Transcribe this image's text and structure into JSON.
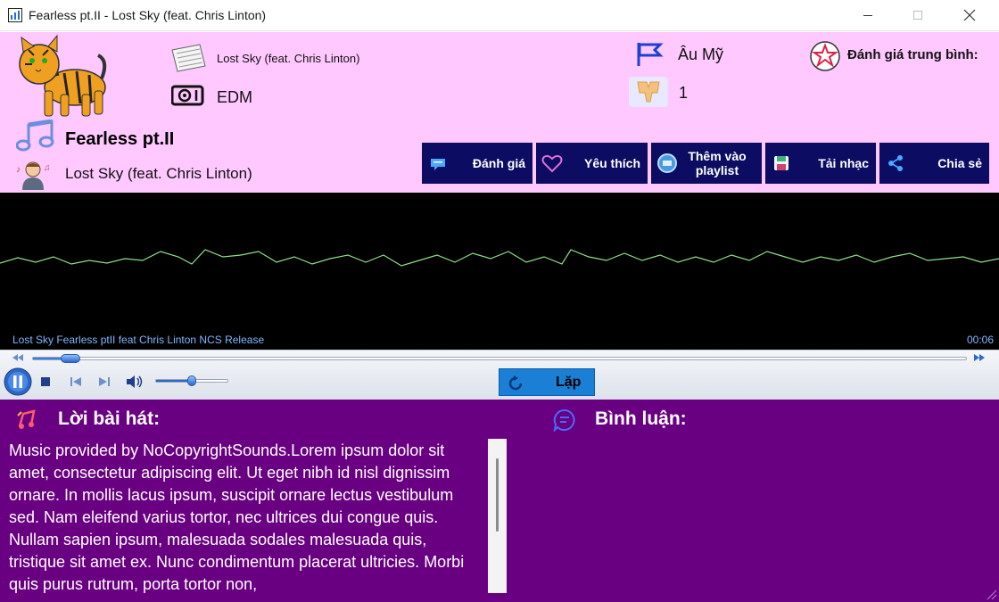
{
  "window": {
    "title": "Fearless pt.II - Lost Sky (feat. Chris Linton)",
    "app_icon": "bar-chart-icon"
  },
  "song": {
    "artist_small": "Lost Sky (feat. Chris Linton)",
    "genre": "EDM",
    "region": "Âu Mỹ",
    "listens": "1",
    "rating_label": "Đánh giá trung bình:",
    "title": "Fearless pt.II",
    "artist": "Lost Sky (feat. Chris Linton)"
  },
  "actions": [
    {
      "label": "Đánh giá",
      "icon": "comment-icon"
    },
    {
      "label": "Yêu thích",
      "icon": "heart-icon"
    },
    {
      "label": "Thêm vào playlist",
      "icon": "playlist-add-icon"
    },
    {
      "label": "Tải nhạc",
      "icon": "download-icon"
    },
    {
      "label": "Chia sẻ",
      "icon": "share-icon"
    }
  ],
  "player": {
    "track_name": "Lost Sky Fearless ptII feat Chris Linton NCS Release",
    "time": "00:06",
    "progress": 0.04,
    "volume": 0.5,
    "loop_label": "Lặp"
  },
  "lyrics": {
    "heading": "Lời bài hát:",
    "text": "Music provided by NoCopyrightSounds.Lorem ipsum dolor sit amet, consectetur adipiscing elit. Ut eget nibh id nisl dignissim ornare. In mollis lacus ipsum, suscipit ornare lectus vestibulum sed. Nam eleifend varius tortor, nec ultrices dui congue quis. Nullam sapien ipsum, malesuada sodales malesuada quis, tristique sit amet ex. Nunc condimentum placerat ultricies. Morbi quis purus rutrum, porta tortor non,"
  },
  "comments": {
    "heading": "Bình luận:"
  },
  "colors": {
    "header_bg": "#ffc8ff",
    "button_bg": "#0c0c63",
    "bottom_bg": "#690082",
    "wave": "#8fe08a"
  }
}
